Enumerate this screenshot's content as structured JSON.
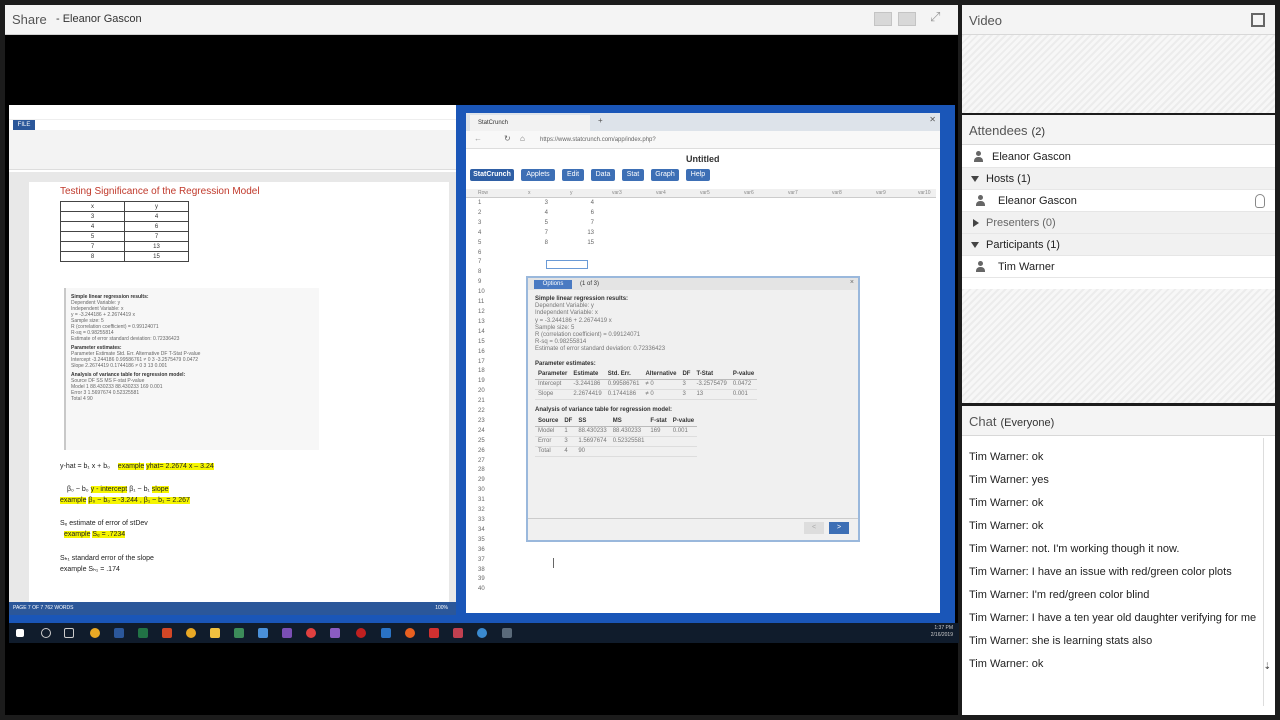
{
  "share": {
    "title": "Share",
    "presenter": "- Eleanor Gascon"
  },
  "word_doc": {
    "title": "Testing Significance of the Regression Model",
    "table_headers": [
      "x",
      "y"
    ],
    "table_rows": [
      [
        "3",
        "4"
      ],
      [
        "4",
        "6"
      ],
      [
        "5",
        "7"
      ],
      [
        "7",
        "13"
      ],
      [
        "8",
        "15"
      ]
    ],
    "output_lines": [
      "Simple linear regression results:",
      "Dependent Variable: y",
      "Independent Variable: x",
      "y = -3.244186 + 2.2674419 x",
      "Sample size: 5",
      "R (correlation coefficient) = 0.99124071",
      "R-sq = 0.98255814",
      "Estimate of error standard deviation: 0.72336423"
    ],
    "notes": {
      "line1_a": "y-hat = b₁ x + b₀",
      "line1_b": "example",
      "line1_c": "yhat= 2.2674 x – 3.24",
      "line2_a": "β₀ ~ b₀",
      "line2_b": "y - intercept",
      "line2_c": "β₁ ~ b₁",
      "line2_d": "slope",
      "line3_a": "example",
      "line3_b": "β₀ ~ b₀ = -3.244 , β₁ ~ b₁ = 2.267",
      "line4": "Sₑ  estimate of error of stDev",
      "line5_a": "example",
      "line5_b": "Sₑ = .7234",
      "line6": "Sₕ₁  standard error of the slope",
      "line7": "example  Sₕ₁ = .174"
    },
    "status_left": "PAGE 7 OF 7    762 WORDS",
    "zoom": "100%"
  },
  "browser": {
    "tab_label": "StatCrunch",
    "url": "https://www.statcrunch.com/app/index.php?",
    "app_title": "Untitled",
    "menu": [
      "StatCrunch",
      "Applets",
      "Edit",
      "Data",
      "Stat",
      "Graph",
      "Help"
    ],
    "col_headers": [
      "Row",
      "x",
      "y",
      "var3",
      "var4",
      "var5",
      "var6",
      "var7",
      "var8",
      "var9",
      "var10"
    ],
    "x_values": [
      "3",
      "4",
      "5",
      "7",
      "8"
    ],
    "y_values": [
      "4",
      "6",
      "7",
      "13",
      "15"
    ],
    "row_count": 40
  },
  "dialog": {
    "options_label": "Options",
    "pager": "(1 of 3)",
    "close": "×",
    "result_heading": "Simple linear regression results:",
    "lines": [
      "Dependent Variable: y",
      "Independent Variable: x",
      "y = -3.244186 + 2.2674419 x",
      "Sample size: 5",
      "R (correlation coefficient) = 0.99124071",
      "R-sq = 0.98255814",
      "Estimate of error standard deviation: 0.72336423"
    ],
    "param_heading": "Parameter estimates:",
    "param_cols": [
      "Parameter",
      "Estimate",
      "Std. Err.",
      "Alternative",
      "DF",
      "T-Stat",
      "P-value"
    ],
    "param_rows": [
      [
        "Intercept",
        "-3.244186",
        "0.99586761",
        "≠ 0",
        "3",
        "-3.2575479",
        "0.0472"
      ],
      [
        "Slope",
        "2.2674419",
        "0.1744186",
        "≠ 0",
        "3",
        "13",
        "0.001"
      ]
    ],
    "anova_heading": "Analysis of variance table for regression model:",
    "anova_cols": [
      "Source",
      "DF",
      "SS",
      "MS",
      "F-stat",
      "P-value"
    ],
    "anova_rows": [
      [
        "Model",
        "1",
        "88.430233",
        "88.430233",
        "169",
        "0.001"
      ],
      [
        "Error",
        "3",
        "1.5697674",
        "0.52325581",
        "",
        ""
      ],
      [
        "Total",
        "4",
        "90",
        "",
        "",
        ""
      ]
    ],
    "next": ">",
    "prev": "<"
  },
  "taskbar": {
    "time": "1:37 PM",
    "date": "2/16/2019"
  },
  "video": {
    "title": "Video"
  },
  "attendees": {
    "title": "Attendees",
    "count": "(2)",
    "top_user": "Eleanor Gascon",
    "hosts_label": "Hosts (1)",
    "host_name": "Eleanor Gascon",
    "presenters_label": "Presenters (0)",
    "participants_label": "Participants (1)",
    "participant_name": "Tim Warner"
  },
  "chat": {
    "title": "Chat",
    "scope": "(Everyone)",
    "messages": [
      {
        "who": "Tim Warner:",
        "text": "ok"
      },
      {
        "who": "Tim Warner:",
        "text": "yes"
      },
      {
        "who": "Tim Warner:",
        "text": "ok"
      },
      {
        "who": "Tim Warner:",
        "text": "ok"
      },
      {
        "who": "Tim Warner:",
        "text": "not. I'm working though it now."
      },
      {
        "who": "Tim Warner:",
        "text": "I have an issue with red/green color plots"
      },
      {
        "who": "Tim Warner:",
        "text": "I'm red/green color blind"
      },
      {
        "who": "Tim Warner:",
        "text": "I have a ten year old daughter verifying for me"
      },
      {
        "who": "Tim Warner:",
        "text": "she is learning stats also"
      },
      {
        "who": "Tim Warner:",
        "text": "ok"
      }
    ]
  },
  "colors": {
    "word_blue": "#2b579a",
    "statcrunch_blue": "#3d6fb5",
    "highlight_yellow": "#f5f500",
    "title_red": "#c0392b",
    "desktop_blue": "#1a56b8"
  }
}
